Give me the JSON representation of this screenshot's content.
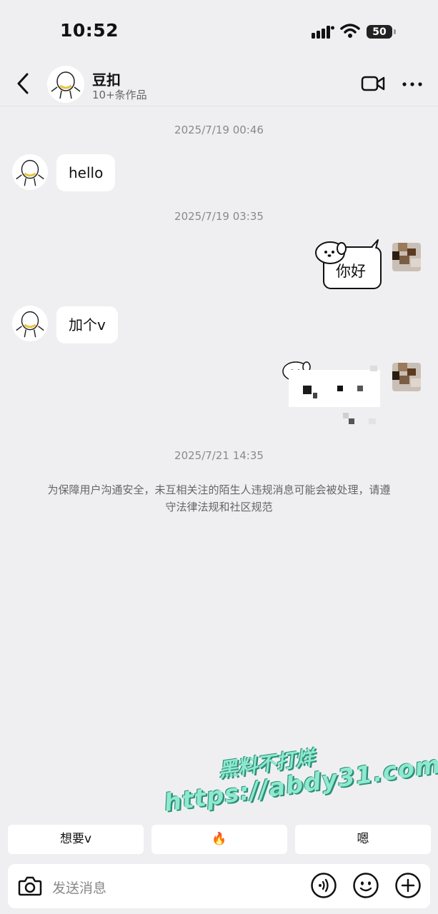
{
  "status_bar": {
    "time": "10:52",
    "battery": "50"
  },
  "header": {
    "name": "豆扣",
    "subtitle": "10+条作品"
  },
  "chat": {
    "messages": [
      {
        "timestamp": "2025/7/19 00:46",
        "side": "left",
        "text": "hello"
      },
      {
        "timestamp": "2025/7/19 03:35",
        "side": "right",
        "text": "你好"
      },
      {
        "side": "left",
        "text": "加个v"
      }
    ],
    "timestamp_last": "2025/7/21 14:35",
    "notice": "为保障用户沟通安全，未互相关注的陌生人违规消息可能会被处理，请遵守法律法规和社区规范"
  },
  "watermark": {
    "line1": "黑料不打烊",
    "line2": "https://abdy31.com"
  },
  "quick_replies": [
    "想要v",
    "🔥",
    "嗯"
  ],
  "input": {
    "placeholder": "发送消息"
  },
  "icons": [
    "back-icon",
    "video-call-icon",
    "more-icon",
    "camera-icon",
    "voice-icon",
    "emoji-icon",
    "plus-icon"
  ]
}
